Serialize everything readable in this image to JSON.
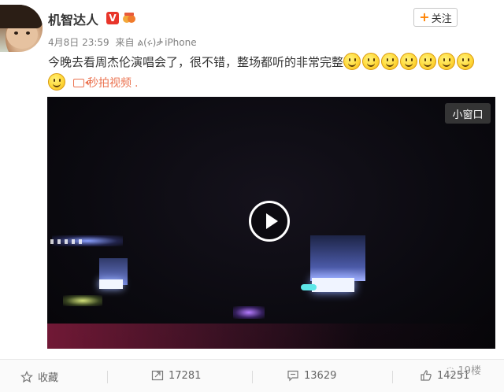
{
  "post": {
    "username": "机智达人",
    "verified_badge": "V",
    "medal_icon": "medal-icon",
    "follow_label": "关注",
    "timestamp": "4月8日 23:59",
    "source_prefix": "来自",
    "source": "iPhone",
    "text": "今晚去看周杰伦演唱会了，很不错，整场都听的非常完整",
    "emoji_count": 8,
    "video_link_label": "秒拍视频",
    "video_link_suffix": "."
  },
  "video": {
    "mini_window_label": "小窗口",
    "play_icon": "play-icon"
  },
  "actions": {
    "favorite_label": "收藏",
    "repost_count": "17281",
    "comment_count": "13629",
    "like_count": "14251"
  },
  "watermark": {
    "text": "19楼"
  },
  "colors": {
    "link": "#eb7350",
    "accent": "#ff8200",
    "verified": "#e8352a"
  }
}
